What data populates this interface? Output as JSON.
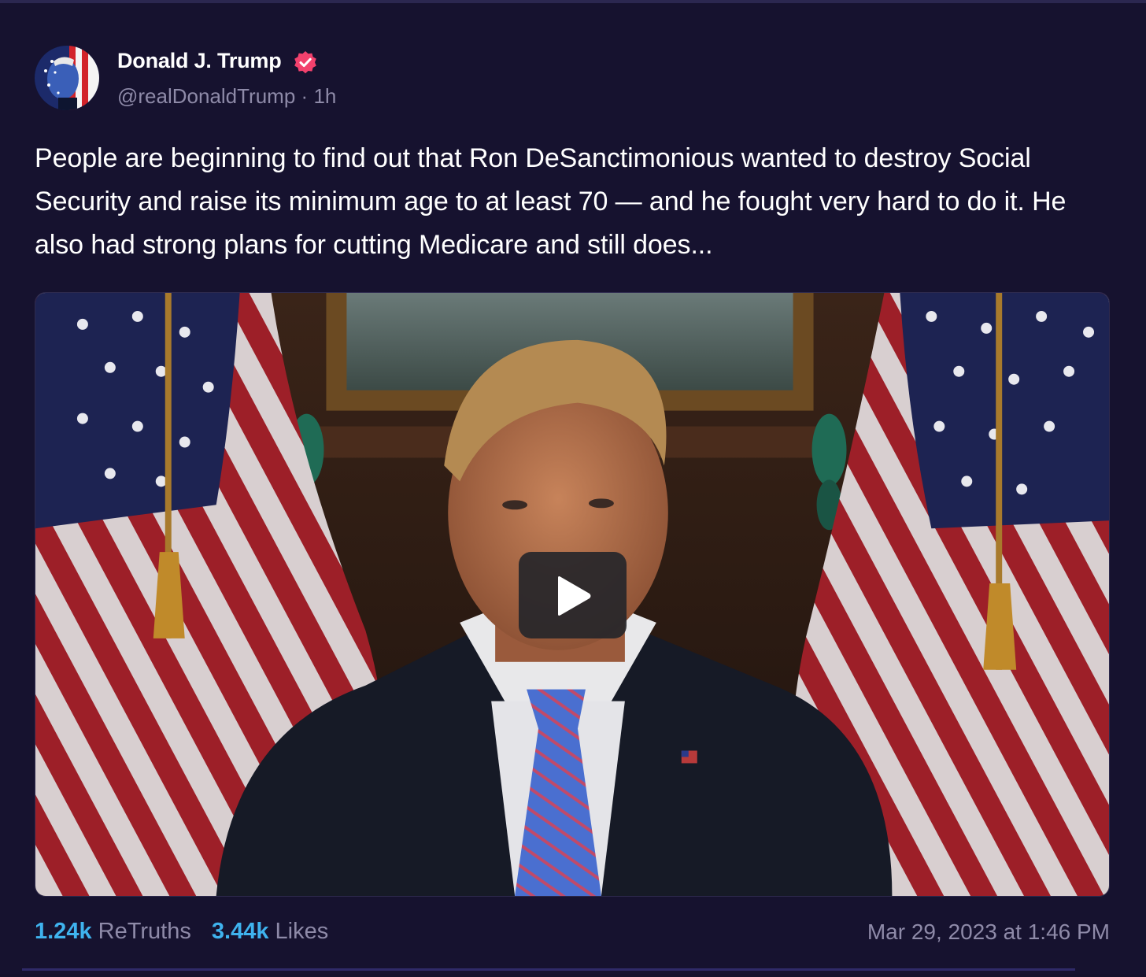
{
  "post": {
    "author_name": "Donald J. Trump",
    "handle": "@realDonaldTrump",
    "separator": "·",
    "relative_time": "1h",
    "verified_icon": "verified-badge-icon",
    "text": "People are beginning to find out that Ron DeSanctimonious wanted to destroy Social Security and raise its minimum age to at least 70 — and he fought very hard to do it. He also had strong plans for cutting Medicare and still does...",
    "media": {
      "type": "video",
      "play_icon": "play-icon"
    },
    "stats": {
      "retruths_count": "1.24k",
      "retruths_label": "ReTruths",
      "likes_count": "3.44k",
      "likes_label": "Likes"
    },
    "timestamp": "Mar 29, 2023 at 1:46 PM"
  },
  "colors": {
    "background": "#16122f",
    "accent_count": "#3fb3ee",
    "verified": "#f2416d",
    "muted_text": "#8e8aa8"
  }
}
